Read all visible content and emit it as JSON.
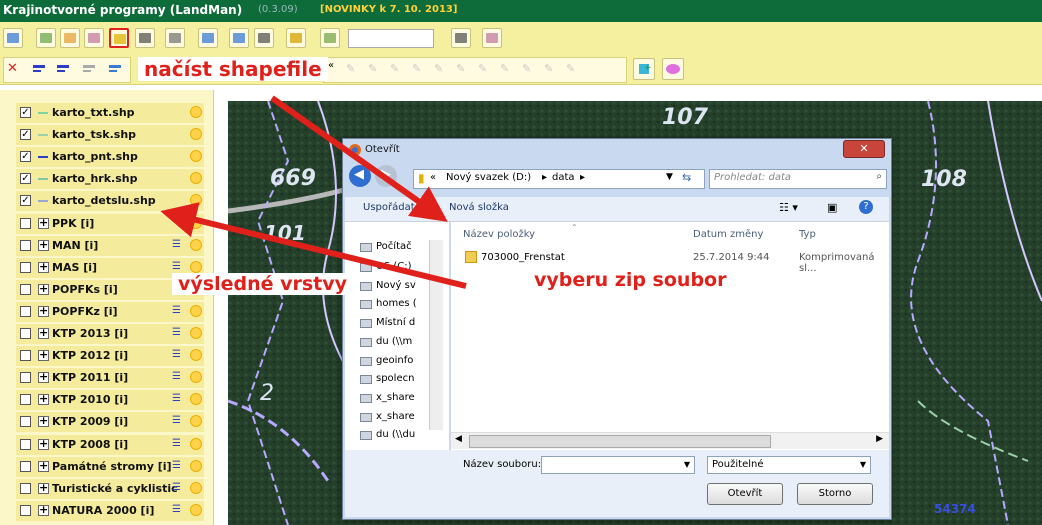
{
  "app": {
    "title": "Krajinotvorné programy (LandMan)",
    "version": "(0.3.09)",
    "news": "[NOVINKY k 7. 10. 2013]"
  },
  "toolbar": {
    "buttons": [
      "globe-icon",
      "layers-grid-icon",
      "layers-stack-icon",
      "layers-open-icon",
      "load-shapefile-icon",
      "list-icon",
      "table-edit-icon",
      "move-icon",
      "sql-icon",
      "calculator-icon",
      "pencil-icon",
      "arrow-select-icon",
      "print-icon",
      "print-preview-icon"
    ],
    "search_value": ""
  },
  "toolbar2": {
    "buttons": [
      "close-icon",
      "lines-icon",
      "tree-icon",
      "eraser-icon",
      "sql-small-icon"
    ],
    "quote_mark": "«"
  },
  "annotations": {
    "load_shapefile": "načíst shapefile",
    "result_layers": "výsledné vrstvy",
    "select_zip": "vyberu zip soubor"
  },
  "layers": [
    {
      "label": "karto_txt.shp",
      "checked": true,
      "color": "#7fd3a0",
      "type": "line"
    },
    {
      "label": "karto_tsk.shp",
      "checked": true,
      "color": "#9ad1a8",
      "type": "line"
    },
    {
      "label": "karto_pnt.shp",
      "checked": true,
      "color": "#2a3ec7",
      "type": "line"
    },
    {
      "label": "karto_hrk.shp",
      "checked": true,
      "color": "#7fc9a8",
      "type": "line"
    },
    {
      "label": "karto_detslu.shp",
      "checked": true,
      "color": "#9aa8d8",
      "type": "line"
    },
    {
      "label": "PPK [i]",
      "checked": false,
      "type": "group"
    },
    {
      "label": "MAN [i]",
      "checked": false,
      "type": "group"
    },
    {
      "label": "MAS [i]",
      "checked": false,
      "type": "group"
    },
    {
      "label": "POPFKs [i]",
      "checked": false,
      "type": "group"
    },
    {
      "label": "POPFKz [i]",
      "checked": false,
      "type": "group"
    },
    {
      "label": "KTP 2013 [i]",
      "checked": false,
      "type": "group"
    },
    {
      "label": "KTP 2012 [i]",
      "checked": false,
      "type": "group"
    },
    {
      "label": "KTP 2011 [i]",
      "checked": false,
      "type": "group"
    },
    {
      "label": "KTP 2010 [i]",
      "checked": false,
      "type": "group"
    },
    {
      "label": "KTP 2009 [i]",
      "checked": false,
      "type": "group"
    },
    {
      "label": "KTP 2008 [i]",
      "checked": false,
      "type": "group"
    },
    {
      "label": "Památné stromy [i]",
      "checked": false,
      "type": "group"
    },
    {
      "label": "Turistické a cyklistic",
      "checked": false,
      "type": "group"
    },
    {
      "label": "NATURA 2000 [i]",
      "checked": false,
      "type": "group"
    }
  ],
  "map": {
    "labels": [
      "107",
      "669",
      "108",
      "101",
      "2",
      "54374"
    ]
  },
  "dialog": {
    "title": "Otevřít",
    "path": [
      "«",
      "Nový svazek (D:)",
      "data"
    ],
    "search_placeholder": "Prohledat: data",
    "organize": "Uspořádat",
    "new_folder": "Nová složka",
    "columns": [
      "Název položky",
      "Datum změny",
      "Typ"
    ],
    "files": [
      {
        "name": "703000_Frenstat",
        "date": "25.7.2014 9:44",
        "type": "Komprimovaná sl..."
      }
    ],
    "nav": [
      "Počítač",
      "OS (C:)",
      "Nový sv",
      "homes (",
      "Místní d",
      "du (\\\\m",
      "geoinfo",
      "spolecn",
      "x_share",
      "x_share",
      "du (\\\\du"
    ],
    "filename_label": "Název souboru:",
    "filename_value": "",
    "filter": "Použitelné",
    "open": "Otevřít",
    "cancel": "Storno"
  }
}
